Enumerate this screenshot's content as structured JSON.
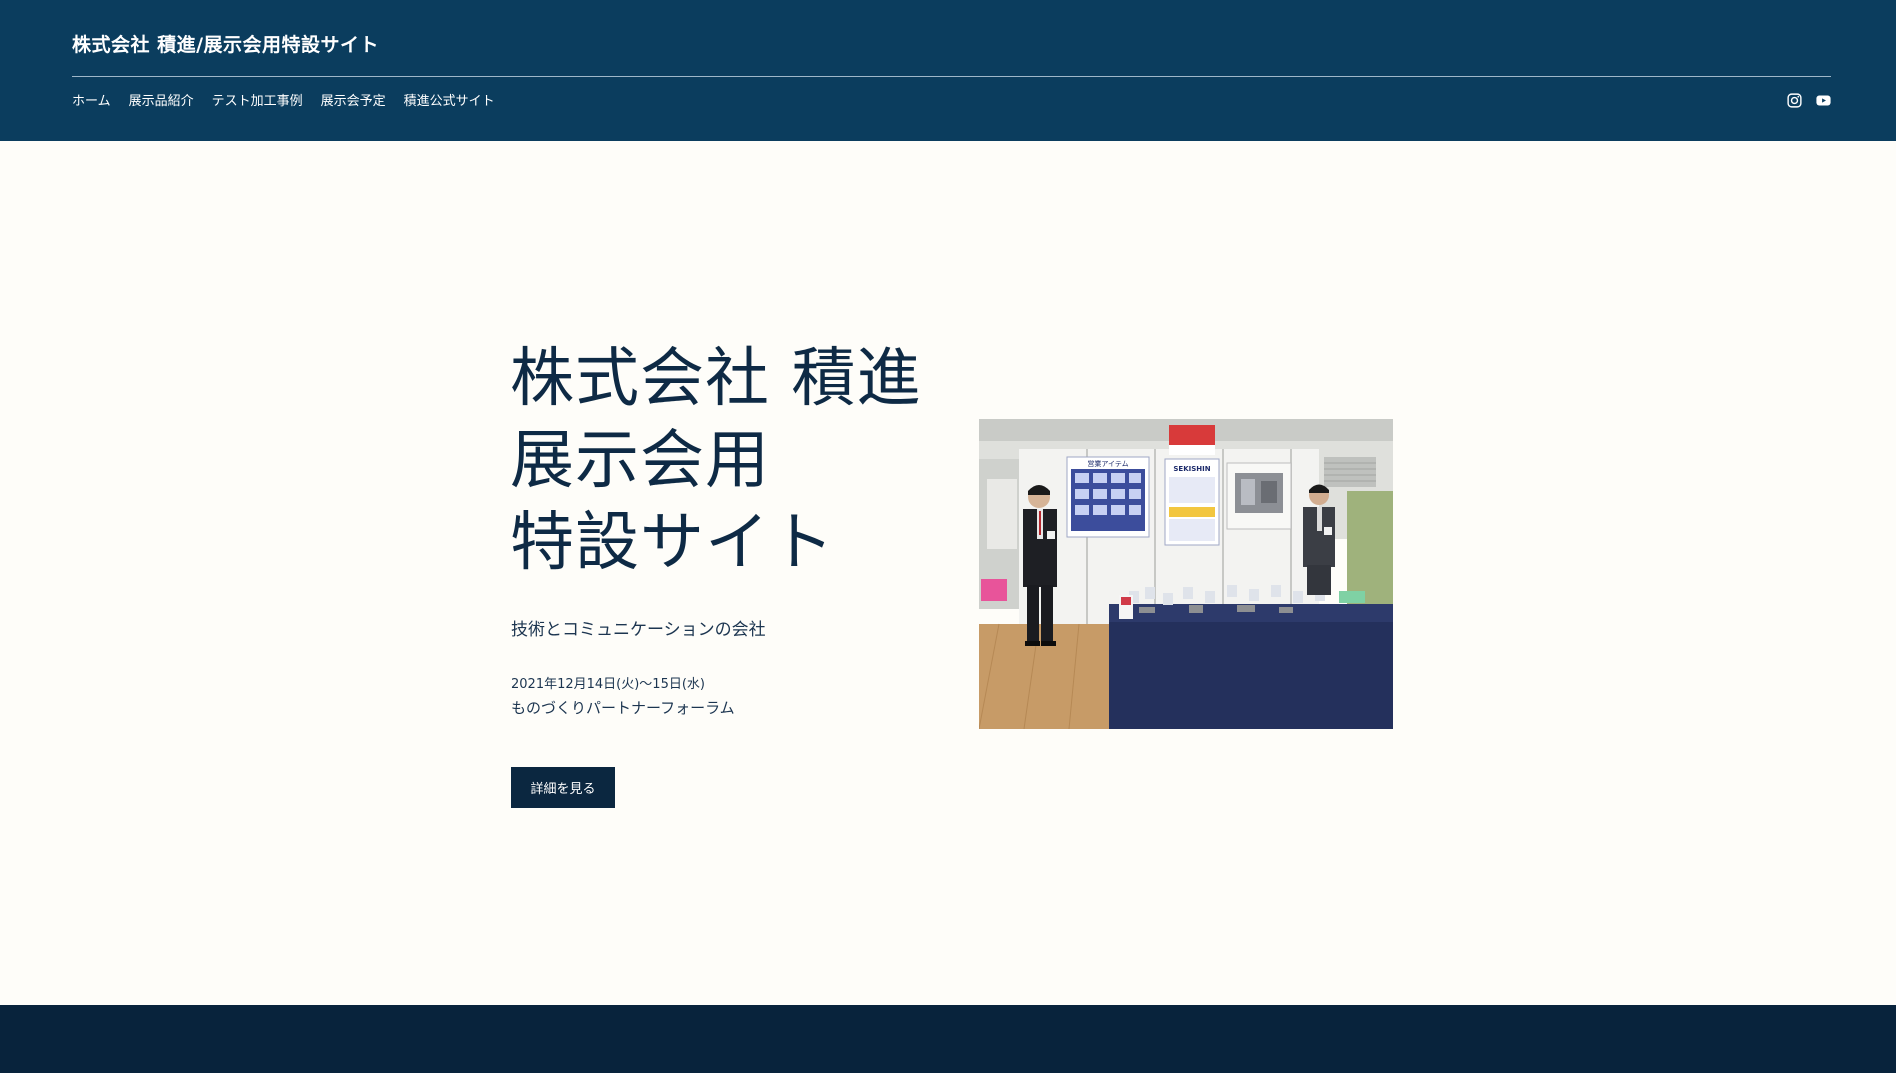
{
  "header": {
    "site_title": "株式会社 積進/展示会用特設サイト",
    "nav": [
      {
        "label": "ホーム"
      },
      {
        "label": "展示品紹介"
      },
      {
        "label": "テスト加工事例"
      },
      {
        "label": "展示会予定"
      },
      {
        "label": "積進公式サイト"
      }
    ],
    "social": [
      "instagram-icon",
      "youtube-icon"
    ]
  },
  "hero": {
    "title_lines": [
      "株式会社 積進",
      "展示会用",
      "特設サイト"
    ],
    "tagline": "技術とコミュニケーションの会社",
    "date": "2021年12月14日(火)〜15日(水)",
    "event": "ものづくりパートナーフォーラム",
    "cta_label": "詳細を見る"
  },
  "photo": {
    "panel_badge": "SEKISHIN",
    "poster_title": "営業アイテム"
  },
  "colors": {
    "header_bg": "#0b3d5e",
    "footer_bg": "#08233c",
    "page_bg": "#fefdf9",
    "button_bg": "#0b2740",
    "text": "#0e2a45"
  }
}
